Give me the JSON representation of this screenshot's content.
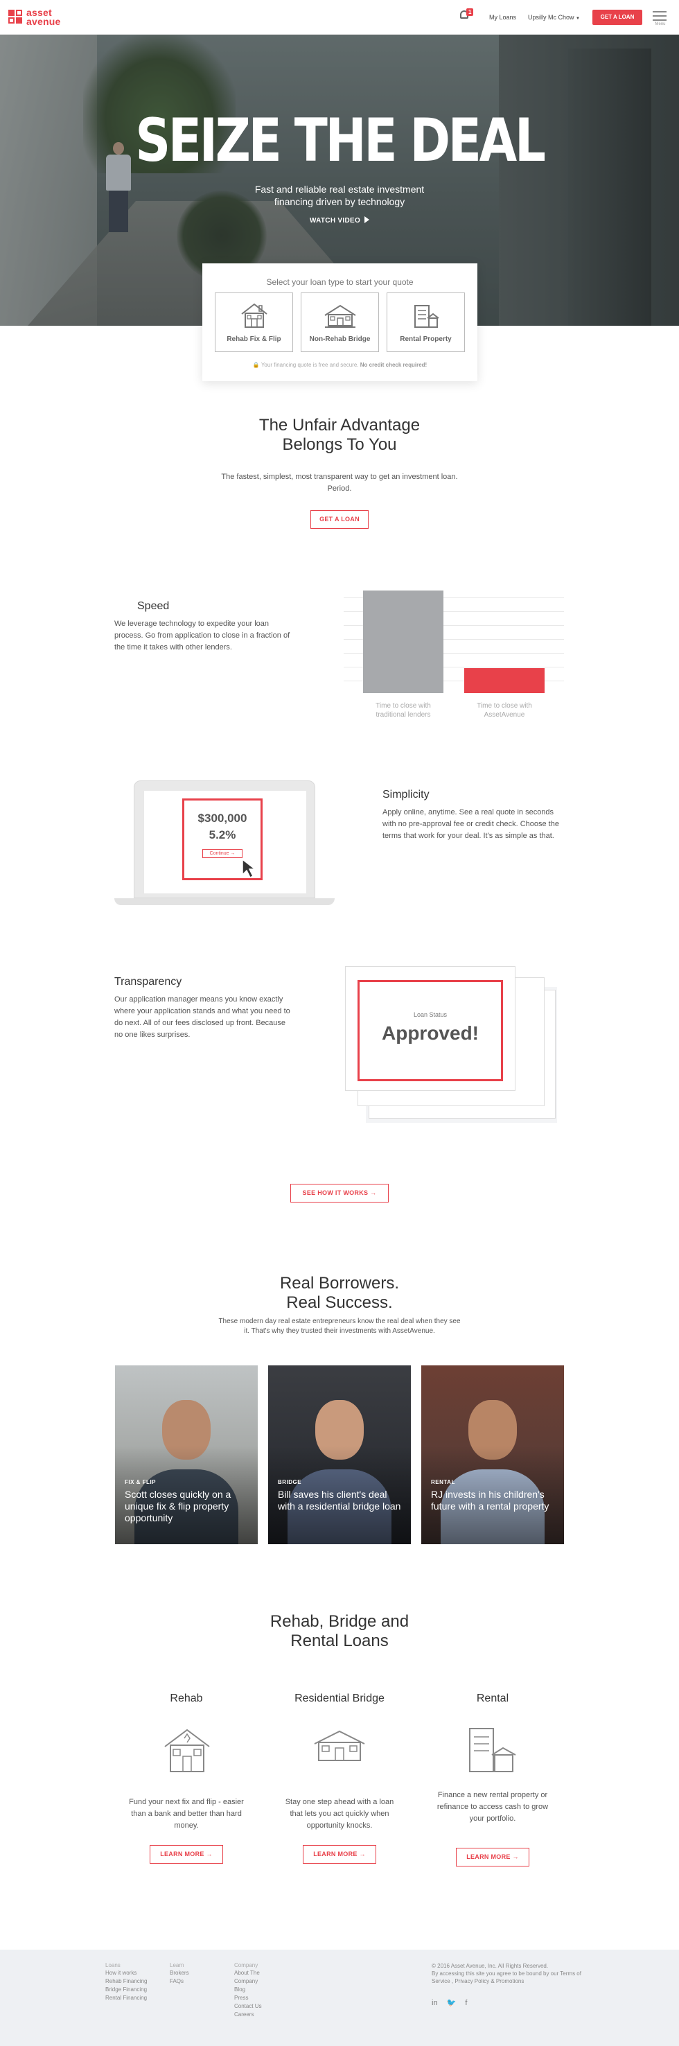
{
  "header": {
    "logo_line1": "asset",
    "logo_line2": "avenue",
    "notification_count": "1",
    "my_loans": "My Loans",
    "user_name": "Upsilly Mc Chow",
    "cta": "GET A LOAN",
    "menu_label": "Menu"
  },
  "hero": {
    "title": "SEIZE THE DEAL",
    "subtitle": "Fast and reliable real estate investment financing driven by technology",
    "video_link": "WATCH VIDEO"
  },
  "quote": {
    "title": "Select your loan type to start your quote",
    "options": [
      {
        "label": "Rehab Fix & Flip",
        "icon": "house-icon"
      },
      {
        "label": "Non-Rehab Bridge",
        "icon": "bridge-house-icon"
      },
      {
        "label": "Rental Property",
        "icon": "rental-building-icon"
      }
    ],
    "note_plain": "Your financing quote is free and secure.",
    "note_bold": "No credit check required!"
  },
  "advantage": {
    "title_line1": "The Unfair Advantage",
    "title_line2": "Belongs To You",
    "text_line1": "The fastest, simplest, most transparent way to get an investment loan.",
    "text_line2": "Period.",
    "cta": "GET A LOAN"
  },
  "speed": {
    "title": "Speed",
    "text": "We leverage technology to expedite your loan process. Go from application to close in a fraction of the time it takes with other lenders."
  },
  "chart_data": {
    "type": "bar",
    "categories": [
      "Time to close with traditional lenders",
      "Time to close with AssetAvenue"
    ],
    "values": [
      100,
      24
    ],
    "ylim": [
      0,
      100
    ],
    "colors": [
      "#a7a9ac",
      "#e8414a"
    ],
    "grid": true
  },
  "simplicity": {
    "title": "Simplicity",
    "text": "Apply online, anytime. See a real quote in seconds with no pre-approval fee or credit check. Choose the terms that work for your deal. It's as simple as that.",
    "quote_amount": "$300,000",
    "quote_rate": "5.2%",
    "quote_button": "Continue →"
  },
  "transparency": {
    "title": "Transparency",
    "text": "Our application manager means you know exactly where your application stands and what you need to do next. All of our fees disclosed up front. Because no one likes surprises.",
    "status_label": "Loan Status",
    "status_value": "Approved!"
  },
  "how_it_works": "SEE HOW IT WORKS",
  "borrowers": {
    "title_line1": "Real Borrowers.",
    "title_line2": "Real Success.",
    "text_line1": "These modern day real estate entrepreneurs know the real deal when they see",
    "text_line2": "it. That's why they trusted their investments with AssetAvenue.",
    "cards": [
      {
        "tag": "FIX & FLIP",
        "headline": "Scott closes quickly on a unique fix & flip property opportunity"
      },
      {
        "tag": "BRIDGE",
        "headline": "Bill saves his client's deal with a residential bridge loan"
      },
      {
        "tag": "RENTAL",
        "headline": "RJ invests in his children's future with a rental property"
      }
    ]
  },
  "products": {
    "title_line1": "Rehab, Bridge and",
    "title_line2": "Rental Loans",
    "items": [
      {
        "title": "Rehab",
        "text": "Fund your next fix and flip - easier than a bank and better than hard money.",
        "cta": "LEARN MORE"
      },
      {
        "title": "Residential Bridge",
        "text": "Stay one step ahead with a loan that lets you act quickly when opportunity knocks.",
        "cta": "LEARN MORE"
      },
      {
        "title": "Rental",
        "text": "Finance a new rental property or refinance to access cash to grow your portfolio.",
        "cta": "LEARN MORE"
      }
    ]
  },
  "footer": {
    "col1": {
      "head": "Loans",
      "links": [
        "How it works",
        "Rehab Financing",
        "Bridge Financing",
        "Rental Financing"
      ]
    },
    "col2": {
      "head": "Learn",
      "links": [
        "Brokers",
        "FAQs"
      ]
    },
    "col3": {
      "head": "Company",
      "links": [
        "About The Company",
        "Blog",
        "Press",
        "Contact Us",
        "Careers"
      ]
    },
    "copyright": "© 2016 Asset Avenue, Inc. All Rights Reserved.",
    "terms": "By accessing this site you agree to be bound by our Terms of Service , Privacy Policy & Promotions",
    "social": [
      "in",
      "🐦",
      "f"
    ]
  }
}
